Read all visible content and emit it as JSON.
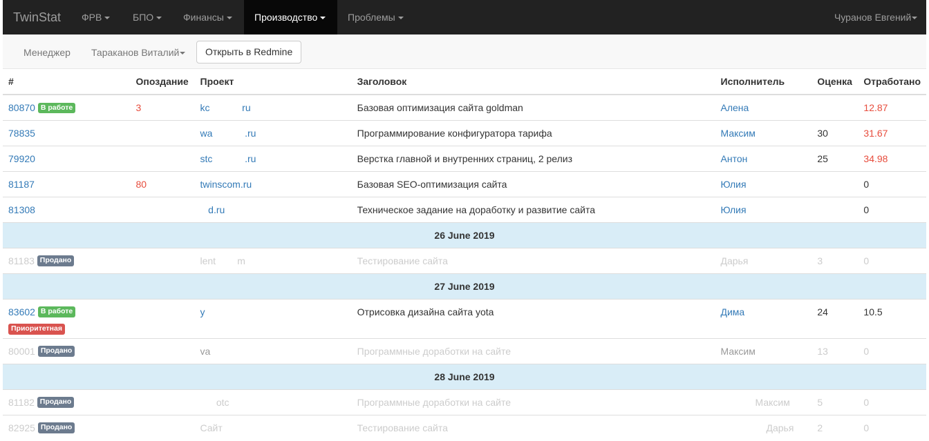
{
  "navbar": {
    "brand": "TwinStat",
    "items": [
      {
        "label": "ФРВ"
      },
      {
        "label": "БПО"
      },
      {
        "label": "Финансы"
      },
      {
        "label": "Производство"
      },
      {
        "label": "Проблемы"
      }
    ],
    "user": "Чуранов Евгений"
  },
  "subbar": {
    "manager_label": "Менеджер",
    "manager_value": "Тараканов Виталий",
    "redmine_button": "Открыть в Redmine"
  },
  "table": {
    "headers": {
      "id": "#",
      "delay": "Опоздание",
      "project": "Проект",
      "title": "Заголовок",
      "executor": "Исполнитель",
      "estimate": "Оценка",
      "worked": "Отработано"
    },
    "rows": [
      {
        "id": "80870",
        "badge": "В работе",
        "delay": "3",
        "project": "kc            ru",
        "title": "Базовая оптимизация сайта goldman",
        "executor": "Алена",
        "estimate": "",
        "worked": "12.87"
      },
      {
        "id": "78835",
        "badge": "",
        "delay": "",
        "project": "wa            .ru",
        "title": "Программирование конфигуратора тарифа",
        "executor": "Максим",
        "estimate": "30",
        "worked": "31.67"
      },
      {
        "id": "79920",
        "badge": "",
        "delay": "",
        "project": "stc            .ru",
        "title": "Верстка главной и внутренних страниц, 2 релиз",
        "executor": "Антон",
        "estimate": "25",
        "worked": "34.98"
      },
      {
        "id": "81187",
        "badge": "",
        "delay": "80",
        "project": "twinscom.ru",
        "title": "Базовая SEO-оптимизация сайта",
        "executor": "Юлия",
        "estimate": "",
        "worked": "0"
      },
      {
        "id": "81308",
        "badge": "",
        "delay": "",
        "project": "   d.ru",
        "title": "Техническое задание на доработку и развитие сайта",
        "executor": "Юлия",
        "estimate": "",
        "worked": "0"
      }
    ],
    "group1": {
      "date": "26 June 2019",
      "rows": [
        {
          "id": "81183",
          "badge": "Продано",
          "project": "lent        m",
          "title": "Тестирование сайта",
          "executor": "Дарья",
          "estimate": "3",
          "worked": "0"
        }
      ]
    },
    "group2": {
      "date": "27 June 2019",
      "row_a": {
        "id": "83602",
        "badge": "В работе",
        "badge2": "Приоритетная",
        "project": "y",
        "title": "Отрисовка дизайна сайта yota",
        "executor": "Дима",
        "estimate": "24",
        "worked": "10.5"
      },
      "row_b": {
        "id": "80001",
        "badge": "Продано",
        "project": "va",
        "title": "Программные доработки на сайте",
        "executor": "Максим",
        "estimate": "13",
        "worked": "0"
      }
    },
    "group3": {
      "date": "28 June 2019",
      "rows": [
        {
          "id": "81182",
          "badge": "Продано",
          "project": "      otc",
          "title": "Программные доработки на сайте",
          "executor": "Максим",
          "estimate": "5",
          "worked": "0"
        },
        {
          "id": "82925",
          "badge": "Продано",
          "project": "Сайт",
          "title": "Тестирование сайта",
          "executor": "Дарья",
          "estimate": "2",
          "worked": "0"
        }
      ]
    }
  },
  "colors": {
    "navbar_bg": "#222222",
    "link": "#337ab7",
    "late": "#e74c3c",
    "badge_in_work": "#5cb85c",
    "badge_priority": "#d9534f",
    "badge_sold": "#6c7b8e",
    "date_row_bg": "#d9edf7"
  }
}
